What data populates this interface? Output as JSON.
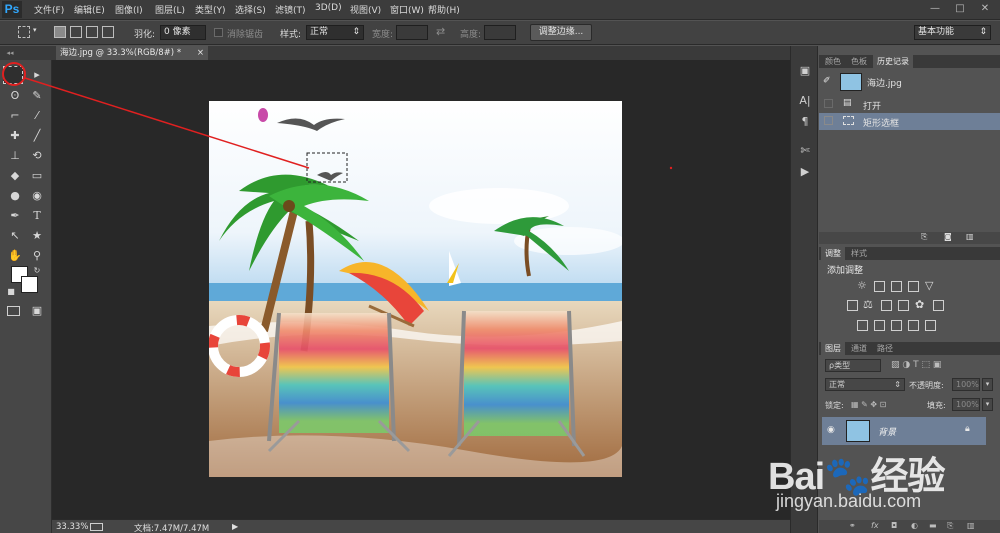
{
  "app": {
    "logo": "Ps",
    "window_buttons": [
      "—",
      "□",
      "✕"
    ]
  },
  "menu": [
    "文件(F)",
    "编辑(E)",
    "图像(I)",
    "图层(L)",
    "类型(Y)",
    "选择(S)",
    "滤镜(T)",
    "3D(D)",
    "视图(V)",
    "窗口(W)",
    "帮助(H)"
  ],
  "options": {
    "feather_label": "羽化:",
    "feather_value": "0 像素",
    "antialias_label": "消除锯齿",
    "style_label": "样式:",
    "style_value": "正常",
    "width_label": "宽度:",
    "height_label": "高度:",
    "refine_button": "调整边缘...",
    "workspace": "基本功能"
  },
  "document_tab": {
    "title": "海边.jpg @ 33.3%(RGB/8#) *",
    "close": "×"
  },
  "status": {
    "zoom": "33.33%",
    "doc_label": "文档:7.47M/7.47M"
  },
  "panels": {
    "top_tabs": [
      "颜色",
      "色板",
      "历史记录"
    ],
    "history_snapshot": "海边.jpg",
    "history_items": [
      "打开",
      "矩形选框"
    ],
    "adjust_tabs": [
      "调整",
      "样式"
    ],
    "adjust_title": "添加调整",
    "layer_tabs": [
      "图层",
      "通道",
      "路径"
    ],
    "layer_kind": "ρ类型",
    "blend_mode": "正常",
    "opacity_label": "不透明度:",
    "opacity_value": "100%",
    "lock_label": "锁定:",
    "fill_label": "填充:",
    "fill_value": "100%",
    "layer_name": "背景"
  },
  "colors": {
    "accent_blue": "#31a8ff",
    "selection_highlight": "#6e7f97",
    "annotation_red": "#e02020"
  },
  "watermark": "Bai 经验 jingyan.baidu.com"
}
